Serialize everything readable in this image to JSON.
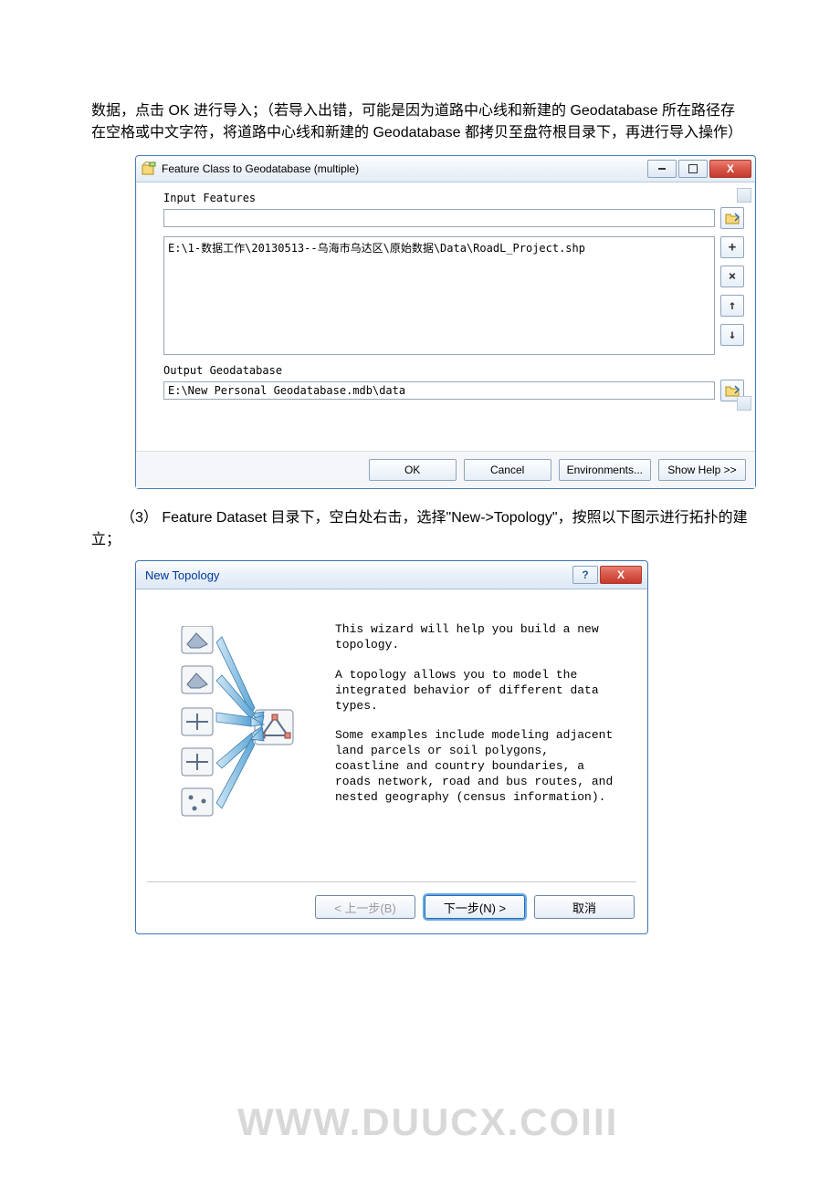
{
  "body_text_1": "数据，点击 OK 进行导入；（若导入出错，可能是因为道路中心线和新建的 Geodatabase 所在路径存在空格或中文字符，将道路中心线和新建的 Geodatabase 都拷贝至盘符根目录下，再进行导入操作）",
  "body_text_2_prefix": "（3） Feature Dataset 目录下，空白处右击，选择\"New->Topology\"，按照以下图示进行拓扑的建立；",
  "watermark": "WWW.DUUCX.COIII",
  "win1": {
    "title": "Feature Class to Geodatabase (multiple)",
    "input_features_label": "Input Features",
    "input_features_value": "",
    "list_items": [
      "E:\\1-数据工作\\20130513--乌海市乌达区\\原始数据\\Data\\RoadL_Project.shp"
    ],
    "output_label": "Output Geodatabase",
    "output_value": "E:\\New Personal Geodatabase.mdb\\data",
    "buttons": {
      "ok": "OK",
      "cancel": "Cancel",
      "env": "Environments...",
      "help": "Show Help >>"
    }
  },
  "win2": {
    "title": "New Topology",
    "para1": "This wizard will help you build a new topology.",
    "para2": "A topology allows you to model the integrated behavior of different data types.",
    "para3": "Some examples include modeling adjacent land parcels or soil polygons, coastline and country boundaries, a roads network, road and bus routes, and nested geography (census information).",
    "buttons": {
      "back": "< 上一步(B)",
      "next": "下一步(N) >",
      "cancel": "取消"
    }
  }
}
